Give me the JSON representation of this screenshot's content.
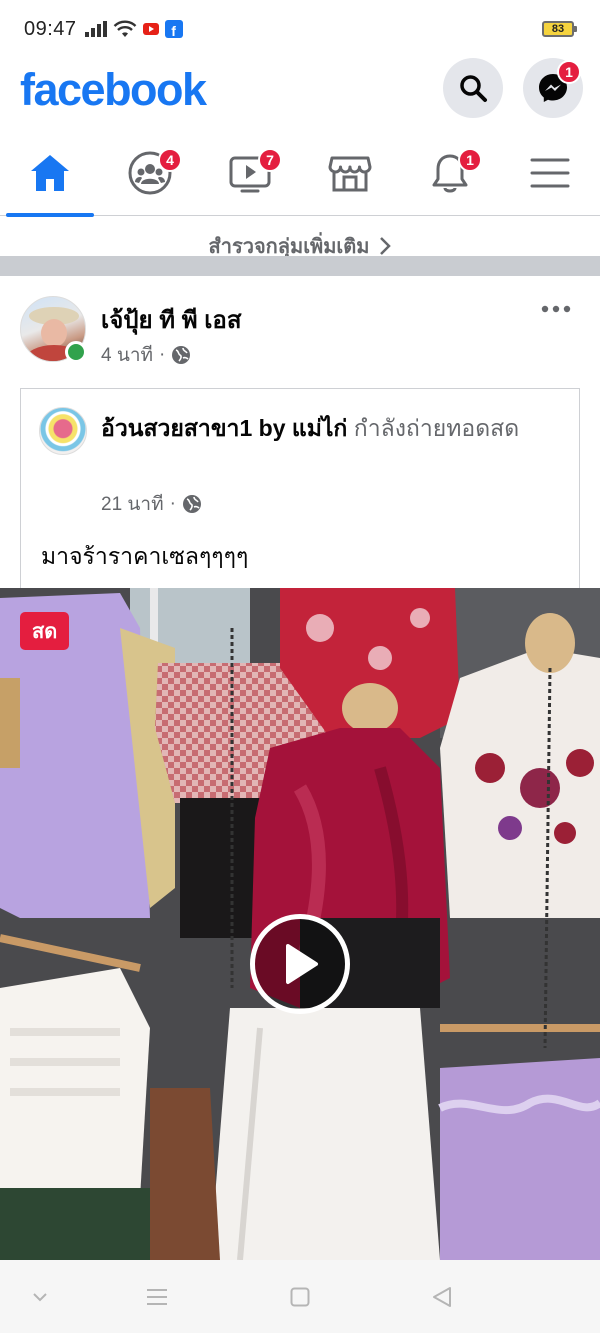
{
  "status_bar": {
    "time": "09:47",
    "battery": "83"
  },
  "header": {
    "logo": "facebook",
    "search_icon": "search-icon",
    "messenger_icon": "messenger-icon",
    "messenger_badge": "1"
  },
  "tabs": [
    {
      "name": "home",
      "icon": "home-icon",
      "badge": "",
      "active": true
    },
    {
      "name": "groups",
      "icon": "groups-icon",
      "badge": "4",
      "active": false
    },
    {
      "name": "watch",
      "icon": "video-icon",
      "badge": "7",
      "active": false
    },
    {
      "name": "marketplace",
      "icon": "store-icon",
      "badge": "",
      "active": false
    },
    {
      "name": "notifications",
      "icon": "bell-icon",
      "badge": "1",
      "active": false
    },
    {
      "name": "menu",
      "icon": "hamburger-icon",
      "badge": "",
      "active": false
    }
  ],
  "explore": {
    "label": "สำรวจกลุ่มเพิ่มเติม"
  },
  "post": {
    "author": "เจ้ปุ้ย ที พี เอส",
    "time": "4 นาที",
    "privacy_icon": "globe-icon",
    "shared": {
      "page_name": "อ้วนสวยสาขา1 by แม่ไก่",
      "activity": " กำลังถ่ายทอดสด",
      "time": "21 นาที",
      "text": "มาจร้าราคาเซลๆๆๆๆ"
    },
    "video": {
      "live_label": "สด"
    }
  },
  "colors": {
    "brand": "#1877f2",
    "badge": "#e41e3f",
    "live": "#e41e3f",
    "online": "#31a24c",
    "secondary_text": "#65676b"
  }
}
